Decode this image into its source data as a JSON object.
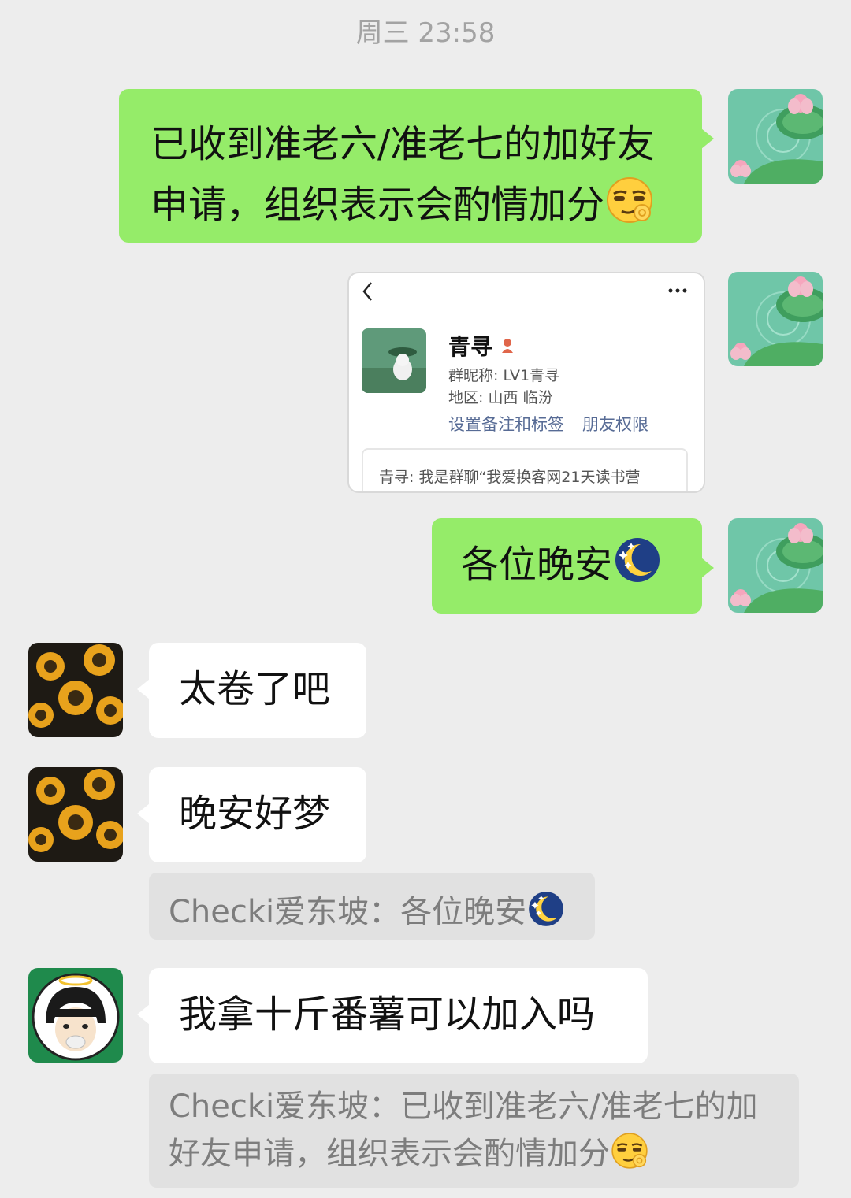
{
  "timestamp": "周三 23:58",
  "messages": [
    {
      "text": "已收到准老六/准老七的加好友申请，组织表示会酌情加分",
      "emoji": "smirk-ok-emoji"
    },
    {
      "card": {
        "name": "青寻",
        "group_nick_label": "群昵称:",
        "group_nick": "LV1青寻",
        "region_label": "地区:",
        "region": "山西  临汾",
        "link_remark": "设置备注和标签",
        "link_perm": "朋友权限",
        "greeting": "青寻: 我是群聊“我爱换客网21天读书营"
      }
    },
    {
      "text": "各位晚安",
      "emoji": "moon-night-emoji"
    },
    {
      "text": "太卷了吧"
    },
    {
      "text": "晚安好梦",
      "quote": "Checki爱东坡：各位晚安"
    },
    {
      "text": "我拿十斤番薯可以加入吗",
      "quote_line1": "Checki爱东坡：已收到准老六/准老七的加",
      "quote_line2": "好友申请，组织表示会酌情加分"
    }
  ],
  "colors": {
    "out_bubble": "#95ec69",
    "in_bubble": "#ffffff",
    "background": "#ededed",
    "link": "#576b95"
  }
}
